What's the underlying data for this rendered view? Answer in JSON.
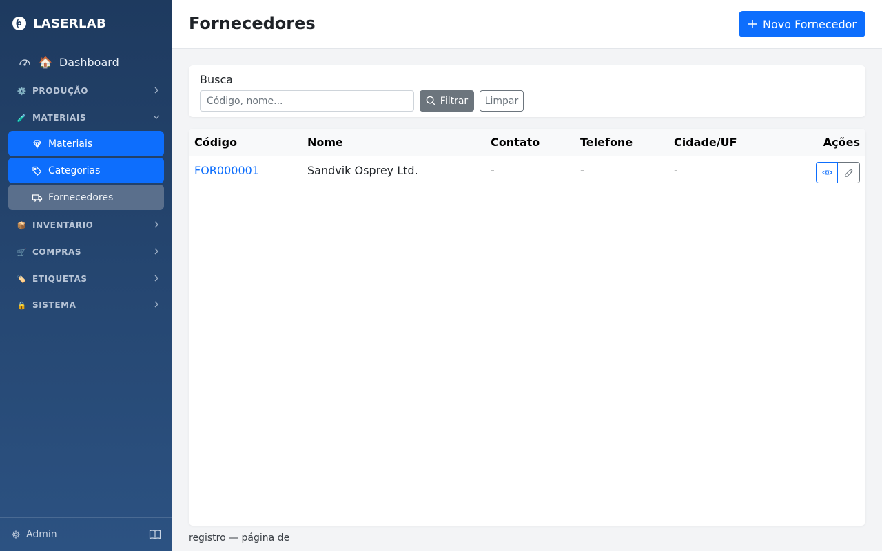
{
  "sidebar": {
    "brand": "LASERLAB",
    "dashboard": {
      "emoji": "🏠",
      "label": "Dashboard"
    },
    "sections": {
      "producao": {
        "emoji": "⚙️",
        "label": "PRODUÇÃO"
      },
      "materiais": {
        "emoji": "🧪",
        "label": "MATERIAIS"
      },
      "inventario": {
        "emoji": "📦",
        "label": "INVENTÁRIO"
      },
      "compras": {
        "emoji": "🛒",
        "label": "COMPRAS"
      },
      "etiquetas": {
        "emoji": "🏷️",
        "label": "ETIQUETAS"
      },
      "sistema": {
        "emoji": "🔒",
        "label": "SISTEMA"
      }
    },
    "materiais_items": [
      {
        "label": "Materiais",
        "icon": "gem-icon"
      },
      {
        "label": "Categorias",
        "icon": "tags-icon"
      },
      {
        "label": "Fornecedores",
        "icon": "truck-icon"
      }
    ],
    "footer": {
      "user": "Admin"
    }
  },
  "header": {
    "title": "Fornecedores",
    "new_button": "Novo Fornecedor"
  },
  "search": {
    "label": "Busca",
    "placeholder": "Código, nome...",
    "value": "",
    "filter_button": "Filtrar",
    "clear_button": "Limpar"
  },
  "table": {
    "columns": [
      "Código",
      "Nome",
      "Contato",
      "Telefone",
      "Cidade/UF",
      "Ações"
    ],
    "rows": [
      {
        "codigo": "FOR000001",
        "nome": "Sandvik Osprey Ltd.",
        "contato": "-",
        "telefone": "-",
        "cidade": "-"
      }
    ]
  },
  "footer": {
    "text": "registro — página de"
  },
  "colors": {
    "primary": "#0d6efd",
    "secondary": "#6c757d",
    "sidebar_top": "#1e3a5f",
    "sidebar_bottom": "#2c5282"
  }
}
